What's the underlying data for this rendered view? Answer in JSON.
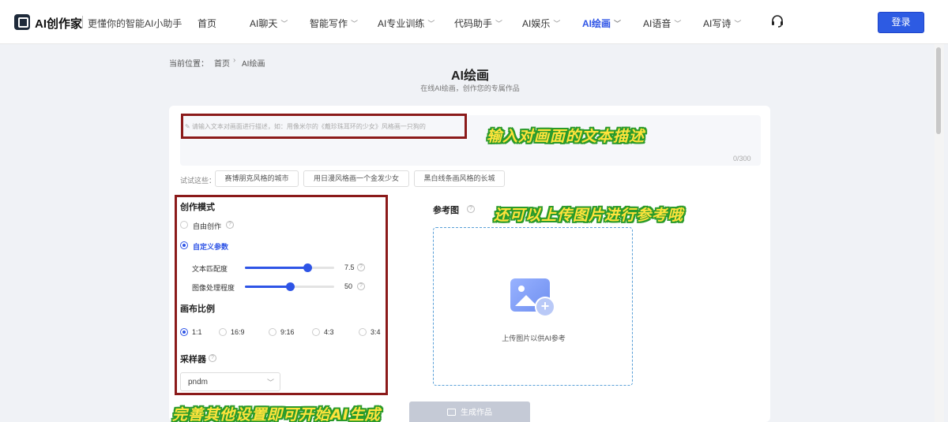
{
  "brand": {
    "name": "AI创作家",
    "slogan": "更懂你的智能AI小助手"
  },
  "nav": [
    {
      "label": "首页",
      "chevron": false,
      "active": false
    },
    {
      "label": "AI聊天",
      "chevron": true,
      "active": false
    },
    {
      "label": "智能写作",
      "chevron": true,
      "active": false
    },
    {
      "label": "AI专业训练",
      "chevron": true,
      "active": false
    },
    {
      "label": "代码助手",
      "chevron": true,
      "active": false
    },
    {
      "label": "AI娱乐",
      "chevron": true,
      "active": false
    },
    {
      "label": "AI绘画",
      "chevron": true,
      "active": true
    },
    {
      "label": "AI语音",
      "chevron": true,
      "active": false
    },
    {
      "label": "AI写诗",
      "chevron": true,
      "active": false
    }
  ],
  "login_label": "登录",
  "breadcrumb": {
    "prefix": "当前位置：",
    "home": "首页",
    "current": "AI绘画"
  },
  "page": {
    "title": "AI绘画",
    "subtitle": "在线AI绘画，创作您的专属作品"
  },
  "prompt": {
    "placeholder": "请输入文本对画面进行描述，如：用像米尔的《戴珍珠耳环的少女》风格画一只狗的",
    "counter": "0/300"
  },
  "try": {
    "label": "试试这些：",
    "chips": [
      "赛博朋克风格的城市",
      "用日漫风格画一个金发少女",
      "黑白线条画风格的长城"
    ]
  },
  "mode": {
    "title": "创作模式",
    "options": [
      {
        "label": "自由创作",
        "selected": false
      },
      {
        "label": "自定义参数",
        "selected": true
      }
    ],
    "sliders": [
      {
        "label": "文本匹配度",
        "value": "7.5",
        "fraction": 0.7
      },
      {
        "label": "图像处理程度",
        "value": "50",
        "fraction": 0.5
      }
    ]
  },
  "canvas": {
    "title": "画布比例",
    "options": [
      {
        "label": "1:1",
        "selected": true
      },
      {
        "label": "16:9",
        "selected": false
      },
      {
        "label": "9:16",
        "selected": false
      },
      {
        "label": "4:3",
        "selected": false
      },
      {
        "label": "3:4",
        "selected": false
      }
    ]
  },
  "sampler": {
    "title": "采样器",
    "value": "pndm"
  },
  "reference": {
    "title": "参考图",
    "upload_text": "上传图片以供AI参考"
  },
  "generate_label": "生成作品",
  "annotations": {
    "prompt": "输入对画面的文本描述",
    "reference": "还可以上传图片进行参考哦",
    "settings": "完善其他设置即可开始AI生成"
  },
  "colors": {
    "accent": "#2e54e6",
    "annotation_box": "#8b1a1a",
    "annotation_text": "#ffe33c",
    "annotation_stroke": "#2a9a2a"
  }
}
